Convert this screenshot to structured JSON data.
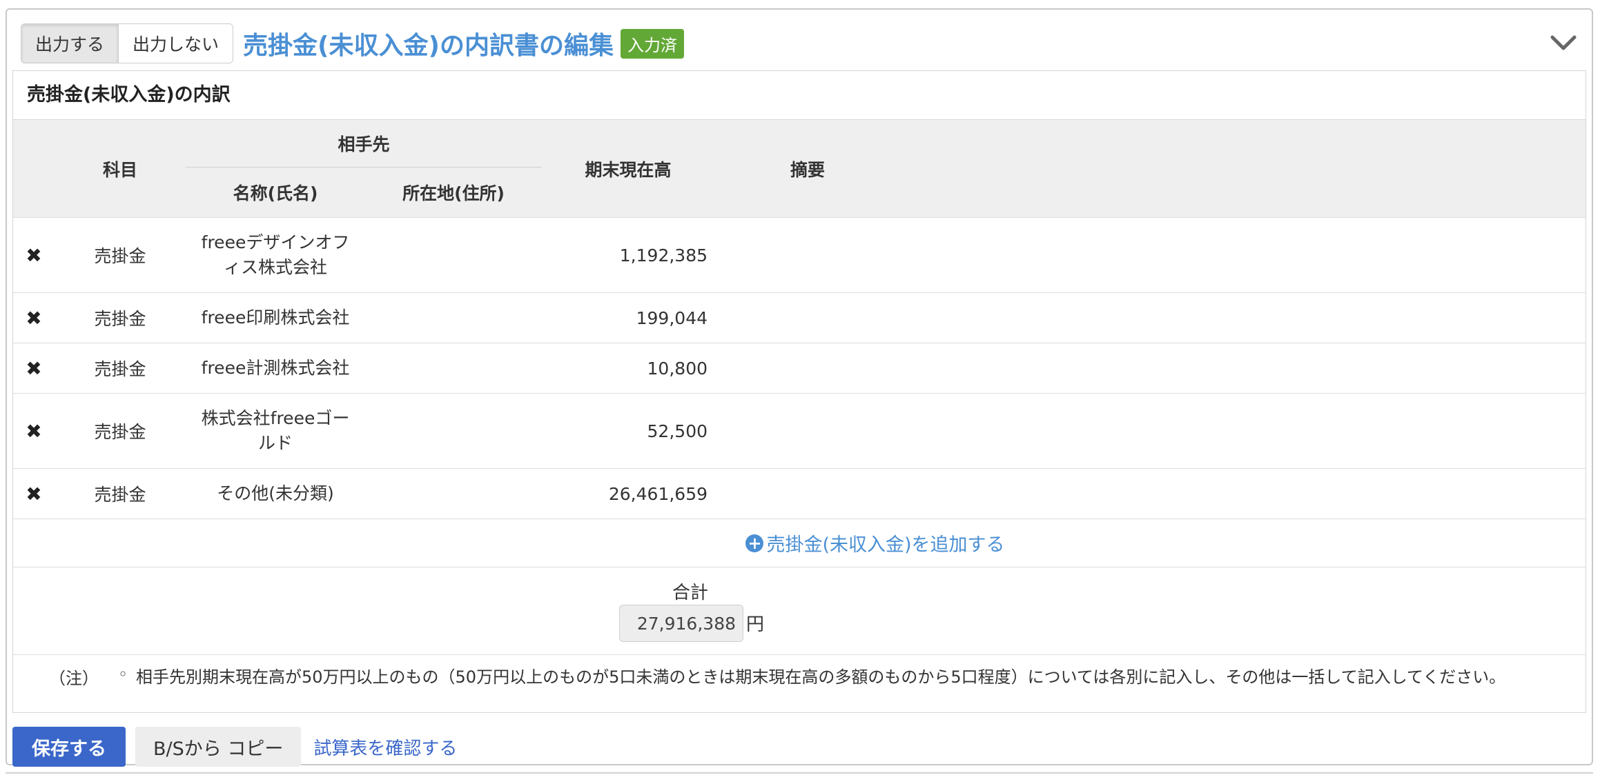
{
  "header": {
    "output_on": "出力する",
    "output_off": "出力しない",
    "title": "売掛金(未収入金)の内訳書の編集",
    "badge": "入力済"
  },
  "section_caption": "売掛金(未収入金)の内訳",
  "columns": {
    "account": "科目",
    "partner_group": "相手先",
    "name": "名称(氏名)",
    "address": "所在地(住所)",
    "balance": "期末現在高",
    "memo": "摘要"
  },
  "rows": [
    {
      "delete": "✖",
      "account": "売掛金",
      "name_line1": "freeeデザインオフ",
      "name_line2": "ィス株式会社",
      "address": "",
      "balance": "1,192,385",
      "memo": ""
    },
    {
      "delete": "✖",
      "account": "売掛金",
      "name_line1": "freee印刷株式会社",
      "name_line2": "",
      "address": "",
      "balance": "199,044",
      "memo": ""
    },
    {
      "delete": "✖",
      "account": "売掛金",
      "name_line1": "freee計測株式会社",
      "name_line2": "",
      "address": "",
      "balance": "10,800",
      "memo": ""
    },
    {
      "delete": "✖",
      "account": "売掛金",
      "name_line1": "株式会社freeeゴー",
      "name_line2": "ルド",
      "address": "",
      "balance": "52,500",
      "memo": ""
    },
    {
      "delete": "✖",
      "account": "売掛金",
      "name_line1": "その他(未分類)",
      "name_line2": "",
      "address": "",
      "balance": "26,461,659",
      "memo": ""
    }
  ],
  "add_link": "売掛金(未収入金)を追加する",
  "total": {
    "label": "合計",
    "value": "27,916,388",
    "unit": "円"
  },
  "note": {
    "label": "（注）",
    "bullet": "◦",
    "text": "相手先別期末現在高が50万円以上のもの（50万円以上のものが5口未満のときは期末現在高の多額のものから5口程度）については各別に記入し、その他は一括して記入してください。"
  },
  "footer": {
    "save": "保存する",
    "copy": "B/Sから コピー",
    "trial_balance": "試算表を確認する"
  }
}
